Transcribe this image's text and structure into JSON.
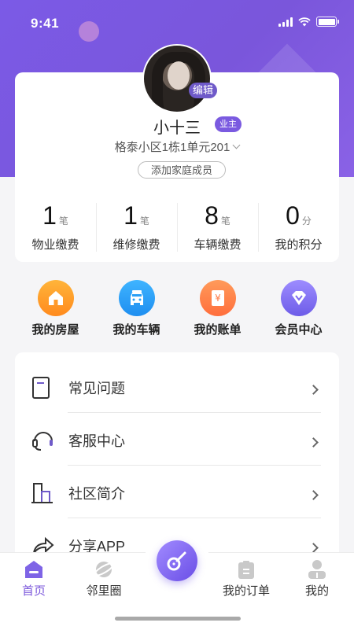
{
  "status_bar": {
    "time": "9:41"
  },
  "profile": {
    "edit_label": "编辑",
    "name": "小十三",
    "owner_badge": "业主",
    "address": "格泰小区1栋1单元201",
    "add_family_label": "添加家庭成员"
  },
  "stats": [
    {
      "value": "1",
      "unit": "笔",
      "label": "物业缴费"
    },
    {
      "value": "1",
      "unit": "笔",
      "label": "维修缴费"
    },
    {
      "value": "8",
      "unit": "笔",
      "label": "车辆缴费"
    },
    {
      "value": "0",
      "unit": "分",
      "label": "我的积分"
    }
  ],
  "quick_actions": [
    {
      "label": "我的房屋",
      "icon": "house-icon",
      "color": "#ff9a2a"
    },
    {
      "label": "我的车辆",
      "icon": "car-icon",
      "color": "#2a9ff5"
    },
    {
      "label": "我的账单",
      "icon": "bill-icon",
      "color": "#ff7a45"
    },
    {
      "label": "会员中心",
      "icon": "vip-diamond-icon",
      "color": "#7e6cf0"
    }
  ],
  "menu": [
    {
      "label": "常见问题",
      "icon": "document-icon"
    },
    {
      "label": "客服中心",
      "icon": "headset-icon"
    },
    {
      "label": "社区简介",
      "icon": "building-icon"
    },
    {
      "label": "分享APP",
      "icon": "share-icon"
    }
  ],
  "tabbar": [
    {
      "label": "首页",
      "icon": "home-tab-icon",
      "active": true
    },
    {
      "label": "邻里圈",
      "icon": "planet-icon",
      "active": false
    },
    {
      "label": "我的订单",
      "icon": "order-icon",
      "active": false
    },
    {
      "label": "我的",
      "icon": "person-icon",
      "active": false
    }
  ],
  "colors": {
    "accent": "#7a56db",
    "badge": "#7a5ae0"
  }
}
